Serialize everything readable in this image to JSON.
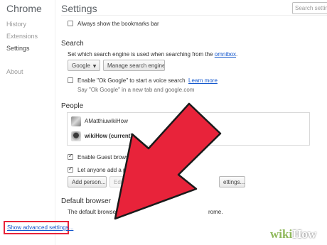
{
  "sidebar": {
    "brand": "Chrome",
    "items": [
      {
        "label": "History"
      },
      {
        "label": "Extensions"
      },
      {
        "label": "Settings"
      },
      {
        "label": "About"
      }
    ]
  },
  "header": {
    "title": "Settings",
    "search_placeholder": "Search settin"
  },
  "appearance": {
    "bookmarks_bar_label": "Always show the bookmarks bar",
    "bookmarks_bar_checked": false
  },
  "search": {
    "title": "Search",
    "description_prefix": "Set which search engine is used when searching from the ",
    "omnibox_link": "omnibox",
    "description_suffix": ".",
    "engine_select": "Google",
    "manage_button": "Manage search engines...",
    "ok_google_label": "Enable \"Ok Google\" to start a voice search",
    "learn_more_link": "Learn more",
    "ok_google_checked": false,
    "ok_google_hint": "Say \"Ok Google\" in a new tab and google.com"
  },
  "people": {
    "title": "People",
    "profiles": [
      {
        "name": "AMatthiuwikiHow"
      },
      {
        "name": "wikiHow (current)"
      }
    ],
    "guest_label": "Enable Guest browsing",
    "guest_checked": true,
    "add_person_label": "Let anyone add a person to",
    "add_person_checked": true,
    "add_person_button": "Add person...",
    "edit_button": "Edit...",
    "import_button_partial": "ettings..."
  },
  "default_browser": {
    "title": "Default browser",
    "text_prefix": "The default browser is c",
    "text_suffix": "rome."
  },
  "advanced_link": "Show advanced settings...",
  "watermark": {
    "wiki": "wiki",
    "how": "How"
  },
  "colors": {
    "arrow_fill": "#e8233a",
    "arrow_outline": "#1a1a1a",
    "link": "#1155cc",
    "highlight_box": "#e8233a"
  }
}
